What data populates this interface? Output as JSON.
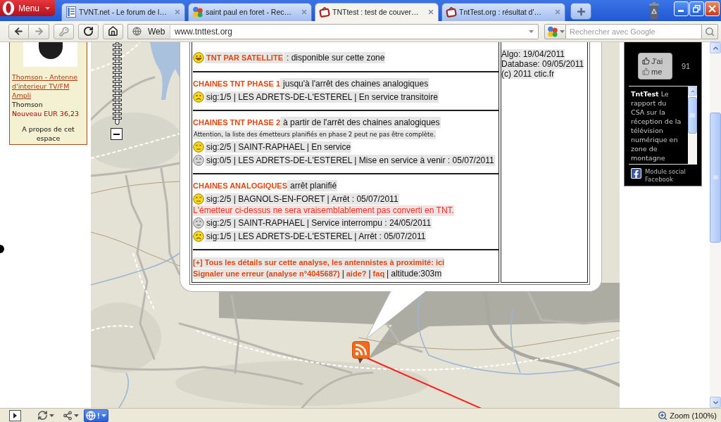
{
  "browser": {
    "menu_button": {
      "label": "Menu"
    },
    "tabs": [
      {
        "kind": "page",
        "title": "TVNT.net - Le forum de l…",
        "selected": false
      },
      {
        "kind": "google",
        "title": "saint paul en foret - Rec…",
        "selected": false
      },
      {
        "kind": "tnt",
        "title": "TNTtest : test de couver…",
        "selected": true
      },
      {
        "kind": "tnt",
        "title": "TntTest.org : résultat d'…",
        "selected": false
      }
    ],
    "address_bar": {
      "badge": "Web",
      "url": "www.tnttest.org"
    },
    "search": {
      "placeholder": "Rechercher avec Google"
    }
  },
  "ad": {
    "link": "Thomson - Antenne d'interieur TV/FM Ampli",
    "brand": "Thomson",
    "price": "Nouveau EUR 36,23",
    "about": "A propos de cet espace"
  },
  "popup": {
    "satellite": {
      "face": {
        "kind": "happy",
        "greyed": false
      },
      "title": "TNT PAR SATELLITE",
      "text": ": disponible sur cette zone"
    },
    "sections": [
      {
        "title": "CHAINES TNT PHASE 1",
        "subtitle": "jusqu'à l'arrêt des chaines analogiques",
        "items": [
          {
            "kind": "station",
            "face": {
              "kind": "sad",
              "greyed": false
            },
            "text": "sig:1/5 | LES ADRETS-DE-L'ESTEREL | En service transitoire"
          }
        ]
      },
      {
        "title": "CHAINES TNT PHASE 2",
        "subtitle": "à partir de l'arrêt des chaines analogiques",
        "items": [
          {
            "kind": "note",
            "text": "Attention, la liste des émetteurs planifiés en phase 2 peut ne pas être complète."
          },
          {
            "kind": "station",
            "face": {
              "kind": "dizzy",
              "greyed": false
            },
            "text": "sig:2/5 | SAINT-RAPHAEL | En service"
          },
          {
            "kind": "station",
            "face": {
              "kind": "dizzy",
              "greyed": true
            },
            "text": "sig:0/5 | LES ADRETS-DE-L'ESTEREL | Mise en service à venir : 05/07/2011"
          }
        ]
      },
      {
        "title": "CHAINES ANALOGIQUES",
        "subtitle": "arrêt planifié",
        "items": [
          {
            "kind": "station",
            "face": {
              "kind": "dizzy",
              "greyed": false
            },
            "text": "sig:2/5 | BAGNOLS-EN-FORET | Arrêt : 05/07/2011"
          },
          {
            "kind": "warning",
            "text": "L'émetteur ci-dessus ne sera vraisemblablement pas converti en TNT."
          },
          {
            "kind": "station",
            "face": {
              "kind": "dizzy",
              "greyed": true
            },
            "text": "sig:2/5 | SAINT-RAPHAEL | Service interrompu : 24/05/2011"
          },
          {
            "kind": "station",
            "face": {
              "kind": "sad",
              "greyed": false
            },
            "text": "sig:1/5 | LES ADRETS-DE-L'ESTEREL | Arrêt : 05/07/2011"
          }
        ]
      }
    ],
    "footer": {
      "details_link": "[+] Tous les détails sur cette analyse, les antennistes à proximité: ici",
      "items": [
        {
          "kind": "link",
          "text": "Signaler une erreur (analyse n°4045687)"
        },
        {
          "kind": "separator",
          "text": "|"
        },
        {
          "kind": "link",
          "text": "aide?"
        },
        {
          "kind": "separator",
          "text": "|"
        },
        {
          "kind": "link",
          "text": "faq"
        },
        {
          "kind": "separator",
          "text": "|"
        },
        {
          "kind": "text",
          "text": "altitude:303m"
        }
      ]
    },
    "info": [
      "Algo: 19/04/2011",
      "Database: 09/05/2011",
      "(c) 2011 ctic.fr"
    ]
  },
  "facebook": {
    "like_button": [
      "J'ai",
      "me"
    ],
    "like_count": "91",
    "post": "**TntTest** Le rapport du CSA sur la réception de la télévision numérique en zone de montagne",
    "footer": "Module social Facebook"
  },
  "status_bar": {
    "turbo": {
      "label": "!",
      "active": true
    },
    "zoom": "Zoom (100%)"
  }
}
